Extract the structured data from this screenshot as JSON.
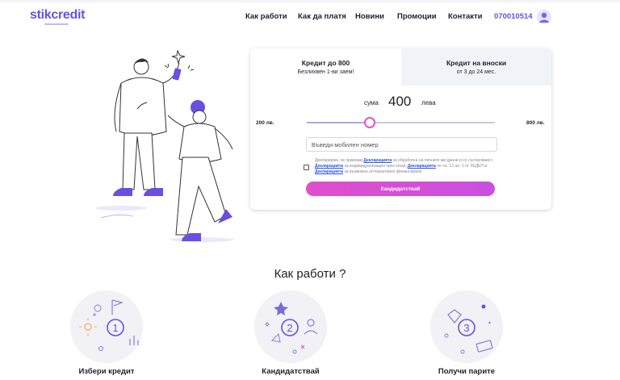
{
  "header": {
    "logo": "stikcredit",
    "nav": [
      "Как работи",
      "Как да платя",
      "Новини",
      "Промоции",
      "Контакти"
    ],
    "phone": "070010514",
    "user_icon": "user-icon"
  },
  "loan_card": {
    "tabs": [
      {
        "title": "Кредит до 800",
        "subtitle": "Безлихвен 1-ви заем!",
        "active": true
      },
      {
        "title": "Кредит на вноски",
        "subtitle": "от 3 до 24 мес.",
        "active": false
      }
    ],
    "amount": {
      "prefix": "сума",
      "value": "400",
      "suffix": "лева"
    },
    "slider": {
      "min_label": "200 лв.",
      "max_label": "800 лв.",
      "min": 200,
      "max": 800,
      "value": 400
    },
    "phone_placeholder": "Въведи мобилен номер",
    "consent": {
      "p1": "Декларирам, че приемам ",
      "link1": "Декларацията",
      "p2": " за обработка на личните ми данни и се съгласявам с ",
      "link2": "Декларацията",
      "p3": " за индивидуализация чрез email, ",
      "link3": "Декларацията",
      "p4": " по чл. 13 ал. 1 от ЗЕДЕП и ",
      "link4": "Декларацията",
      "p5": " за възможно алтернативно финансиране."
    },
    "apply_label": "Кандидатствай"
  },
  "how_it_works": {
    "title": "Как работи ?",
    "steps": [
      {
        "number": "1",
        "label": "Избери кредит",
        "icon": "choose-credit-icon"
      },
      {
        "number": "2",
        "label": "Кандидатствай",
        "icon": "apply-icon"
      },
      {
        "number": "3",
        "label": "Получи парите",
        "icon": "get-money-icon"
      }
    ]
  },
  "colors": {
    "brand": "#6a4fe0",
    "accent": "#e352cf",
    "slider_track": "#c5c8e6"
  }
}
